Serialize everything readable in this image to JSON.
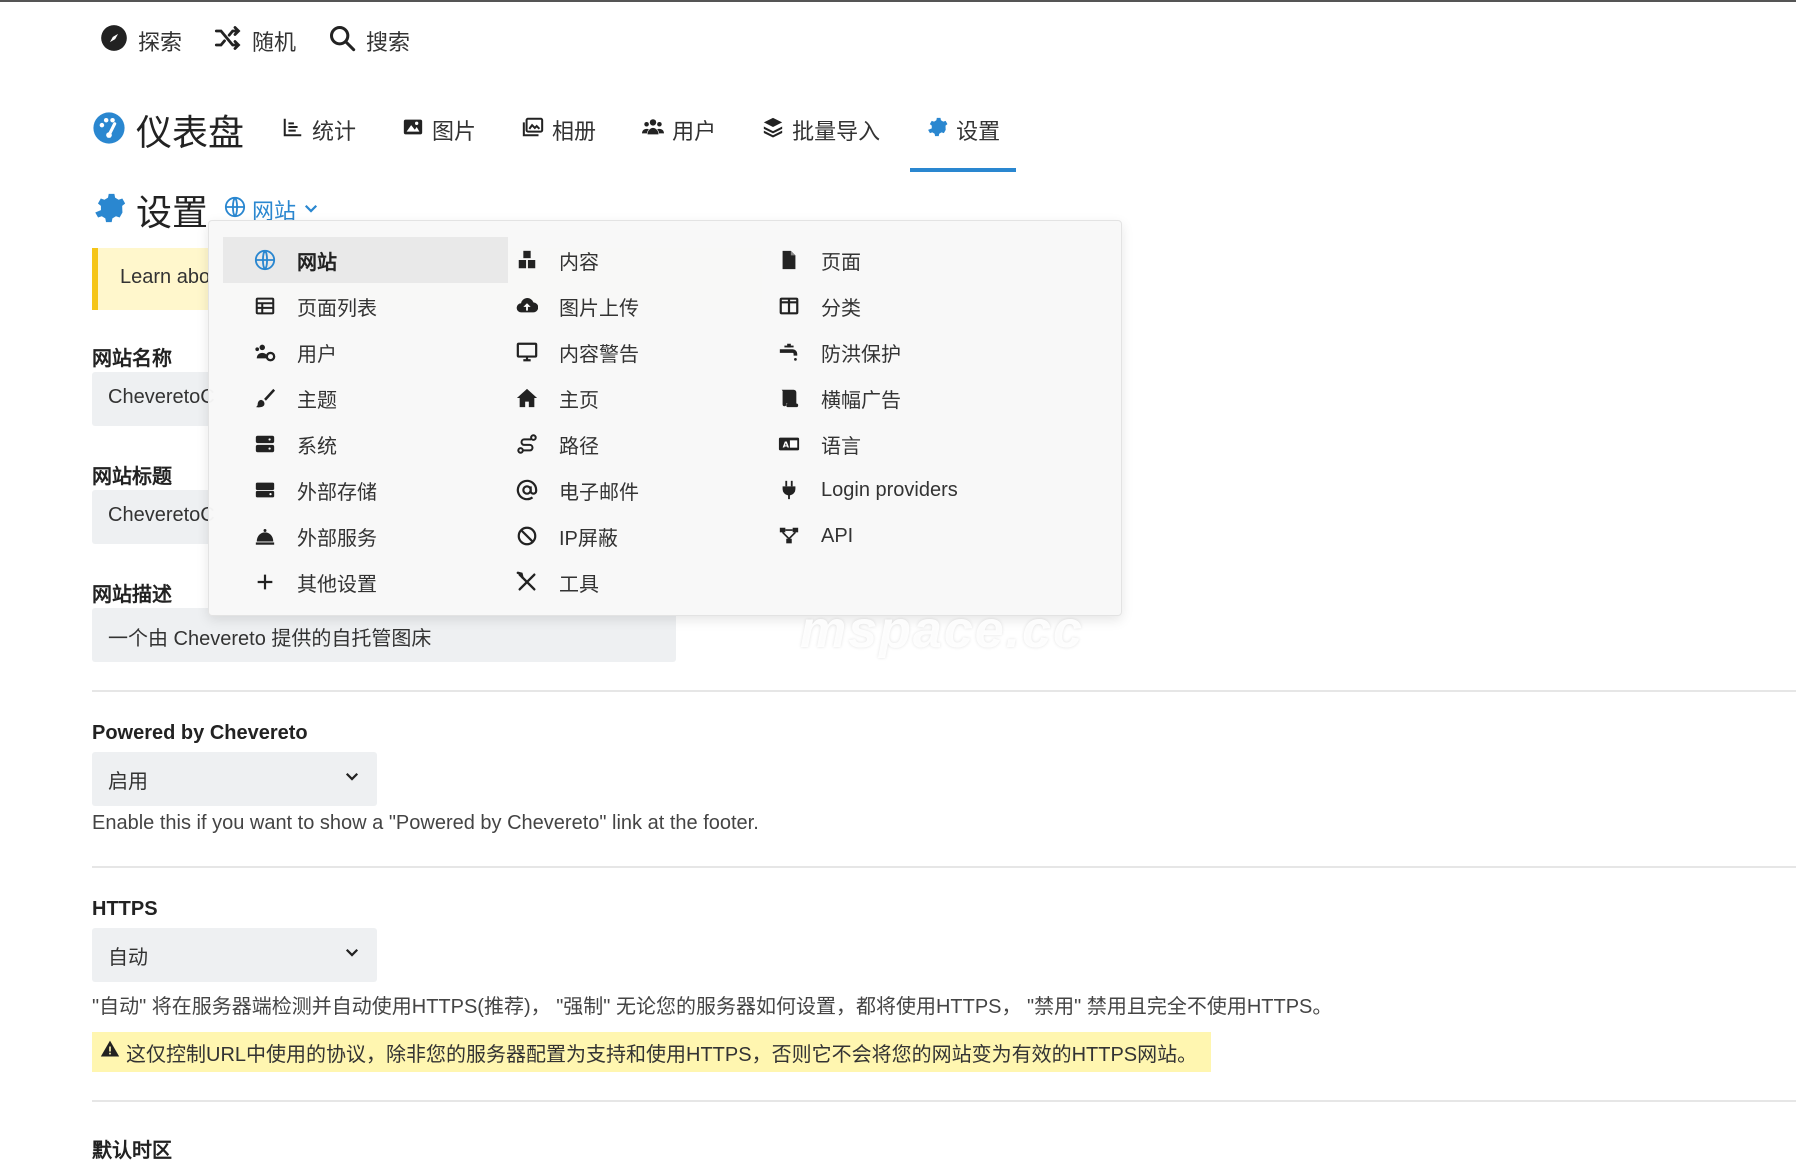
{
  "topnav": {
    "items": [
      {
        "label": "探索",
        "icon": "compass-icon"
      },
      {
        "label": "随机",
        "icon": "shuffle-icon"
      },
      {
        "label": "搜索",
        "icon": "search-icon"
      }
    ]
  },
  "dashboard": {
    "title": "仪表盘",
    "tabs": [
      {
        "label": "统计",
        "icon": "chart-icon"
      },
      {
        "label": "图片",
        "icon": "image-icon"
      },
      {
        "label": "相册",
        "icon": "album-icon"
      },
      {
        "label": "用户",
        "icon": "users-icon"
      },
      {
        "label": "批量导入",
        "icon": "layers-icon"
      },
      {
        "label": "设置",
        "icon": "gear-icon",
        "active": true
      }
    ],
    "accent": "#2a87d0"
  },
  "settings": {
    "title": "设置",
    "section_label": "网站"
  },
  "notice": {
    "text": "Learn abo"
  },
  "fields": {
    "site_name_label": "网站名称",
    "site_name_value": "CheveretoC",
    "site_title_label": "网站标题",
    "site_title_value": "CheveretoC",
    "site_desc_label": "网站描述",
    "site_desc_value": "一个由 Chevereto 提供的自托管图床",
    "powered_label": "Powered by Chevereto",
    "powered_value": "启用",
    "powered_help": "Enable this if you want to show a \"Powered by Chevereto\" link at the footer.",
    "https_label": "HTTPS",
    "https_value": "自动",
    "https_help": "\"自动\" 将在服务器端检测并自动使用HTTPS(推荐)， \"强制\" 无论您的服务器如何设置，都将使用HTTPS， \"禁用\" 禁用且完全不使用HTTPS。",
    "https_warning": "这仅控制URL中使用的协议，除非您的服务器配置为支持和使用HTTPS，否则它不会将您的网站变为有效的HTTPS网站。",
    "timezone_label": "默认时区"
  },
  "menu": {
    "col1": [
      {
        "label": "网站",
        "icon": "globe-icon",
        "selected": true
      },
      {
        "label": "页面列表",
        "icon": "table-icon"
      },
      {
        "label": "用户",
        "icon": "users-cog-icon"
      },
      {
        "label": "主题",
        "icon": "brush-icon"
      },
      {
        "label": "系统",
        "icon": "server-icon"
      },
      {
        "label": "外部存储",
        "icon": "hdd-icon"
      },
      {
        "label": "外部服务",
        "icon": "bell-icon"
      },
      {
        "label": "其他设置",
        "icon": "plus-icon"
      }
    ],
    "col2": [
      {
        "label": "内容",
        "icon": "cubes-icon"
      },
      {
        "label": "图片上传",
        "icon": "cloud-upload-icon"
      },
      {
        "label": "内容警告",
        "icon": "monitor-icon"
      },
      {
        "label": "主页",
        "icon": "home-icon"
      },
      {
        "label": "路径",
        "icon": "route-icon"
      },
      {
        "label": "电子邮件",
        "icon": "at-icon"
      },
      {
        "label": "IP屏蔽",
        "icon": "ban-icon"
      },
      {
        "label": "工具",
        "icon": "tools-icon"
      }
    ],
    "col3": [
      {
        "label": "页面",
        "icon": "file-icon"
      },
      {
        "label": "分类",
        "icon": "columns-icon"
      },
      {
        "label": "防洪保护",
        "icon": "faucet-icon"
      },
      {
        "label": "横幅广告",
        "icon": "scroll-icon"
      },
      {
        "label": "语言",
        "icon": "language-icon"
      },
      {
        "label": "Login providers",
        "icon": "plug-icon"
      },
      {
        "label": "API",
        "icon": "network-icon"
      }
    ]
  },
  "watermark": "mspace.cc"
}
